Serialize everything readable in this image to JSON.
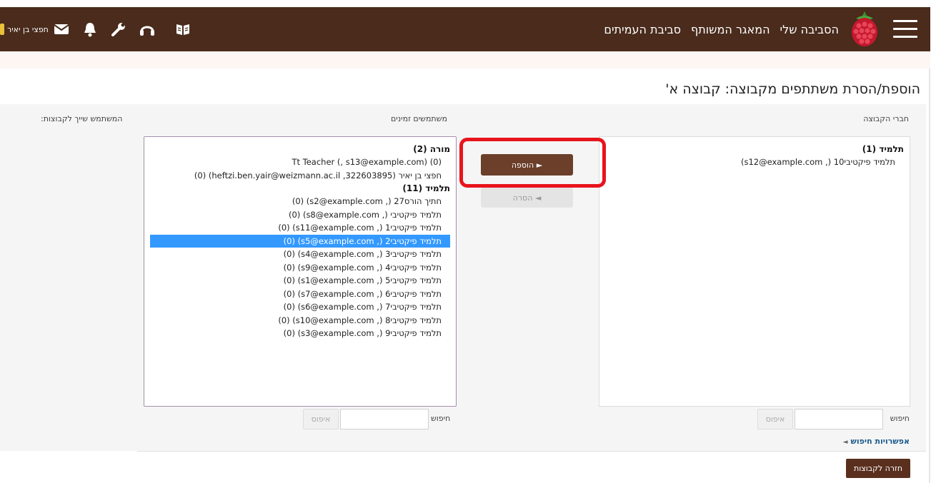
{
  "navbar": {
    "links": [
      "הסביבה שלי",
      "המאגר המשותף",
      "סביבת העמיתים"
    ],
    "user_name": "חפצי בן יאיר",
    "icons": [
      "book-icon",
      "headset-icon",
      "wrench-icon",
      "bell-icon",
      "mail-icon"
    ],
    "bg_color": "#4a2b1c"
  },
  "page": {
    "title": "הוספת/הסרת משתתפים מקבוצה: קבוצה א'"
  },
  "columns": {
    "members_label": "חברי הקבוצה",
    "available_label": "משתמשים זמינים",
    "user_groups_label": "המשתמש שייך לקבוצות:"
  },
  "members": {
    "groups": [
      {
        "label": "תלמיד (1)",
        "items": [
          "תלמיד פיקטיבי10 (, s12@example.com)"
        ]
      }
    ]
  },
  "available": {
    "groups": [
      {
        "label": "מורה (2)",
        "items": [
          "Tt Teacher (, s13@example.com) (0)",
          "חפצי בן יאיר (heftzi.ben.yair@weizmann.ac.il ,322603895) (0)"
        ]
      },
      {
        "label": "תלמיד (11)",
        "items": [
          "חתיך הורס27 (, s2@example.com) (0)",
          "תלמיד פיקטיבי (, s8@example.com) (0)",
          "תלמיד פיקטיבי1 (, s11@example.com) (0)",
          "תלמיד פיקטיבי2 (, s5@example.com) (0)",
          "תלמיד פיקטיבי3 (, s4@example.com) (0)",
          "תלמיד פיקטיבי4 (, s9@example.com) (0)",
          "תלמיד פיקטיבי5 (, s1@example.com) (0)",
          "תלמיד פיקטיבי6 (, s7@example.com) (0)",
          "תלמיד פיקטיבי7 (, s6@example.com) (0)",
          "תלמיד פיקטיבי8 (, s10@example.com) (0)",
          "תלמיד פיקטיבי9 (, s3@example.com) (0)"
        ]
      }
    ],
    "selected": "תלמיד פיקטיבי2 (, s5@example.com) (0)"
  },
  "actions": {
    "add_label": "► הוספה",
    "remove_label": "◄ הסרה",
    "back_label": "חזרה לקבוצות"
  },
  "search": {
    "label": "חיפוש",
    "reset_label": "איפוס",
    "options_label": "אפשרויות חיפוש"
  },
  "colors": {
    "selected_row": "#3399ff",
    "highlight_ring": "#e8141c",
    "button_brown": "#6b3f2a"
  }
}
